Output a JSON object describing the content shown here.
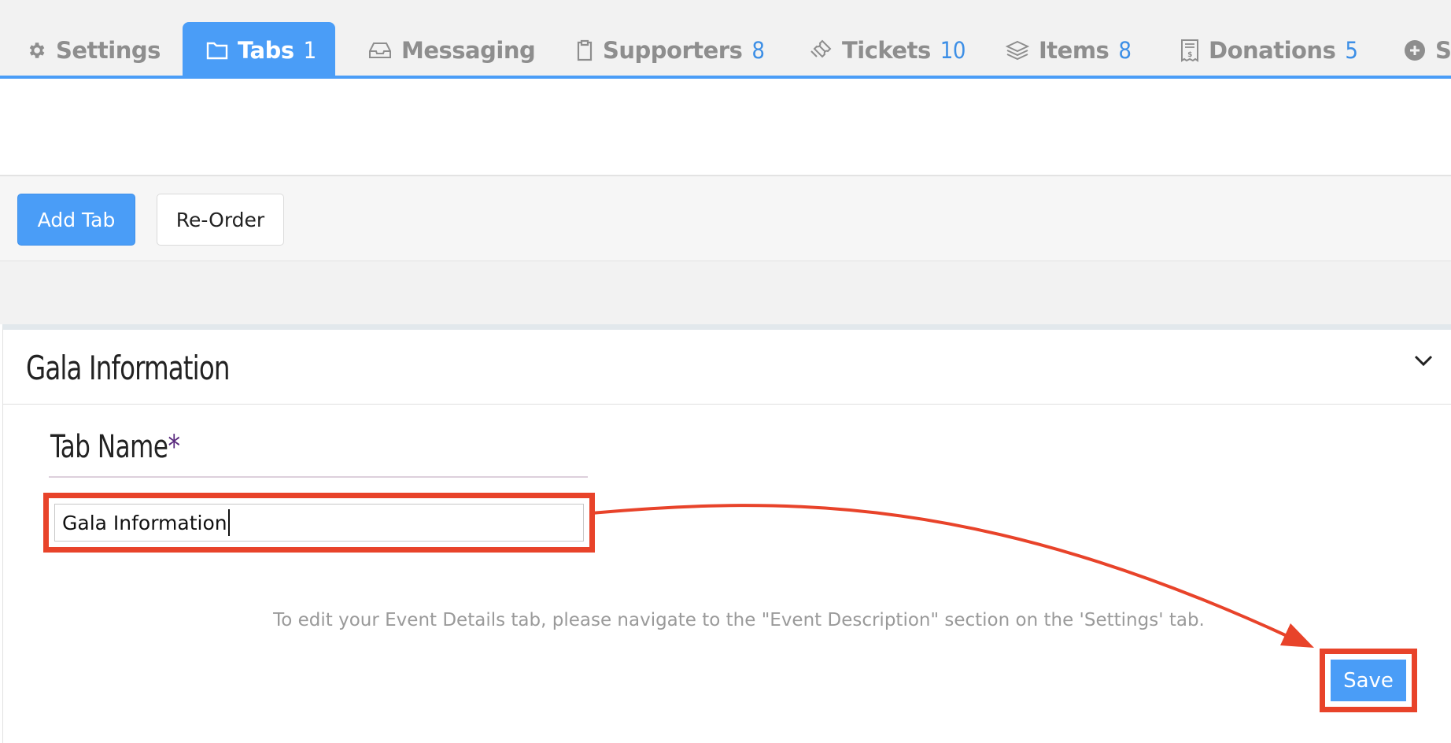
{
  "tabs": [
    {
      "label": "Settings",
      "icon": "gear-icon",
      "count": null,
      "active": false
    },
    {
      "label": "Tabs",
      "icon": "folder-icon",
      "count": "1",
      "active": true
    },
    {
      "label": "Messaging",
      "icon": "inbox-icon",
      "count": null,
      "active": false
    },
    {
      "label": "Supporters",
      "icon": "clipboard-icon",
      "count": "8",
      "active": false
    },
    {
      "label": "Tickets",
      "icon": "ticket-icon",
      "count": "10",
      "active": false
    },
    {
      "label": "Items",
      "icon": "layers-icon",
      "count": "8",
      "active": false
    },
    {
      "label": "Donations",
      "icon": "receipt-icon",
      "count": "5",
      "active": false
    },
    {
      "label": "S",
      "icon": "plus-circle-icon",
      "count": null,
      "active": false
    }
  ],
  "toolbar": {
    "add_tab_label": "Add Tab",
    "reorder_label": "Re-Order"
  },
  "panel": {
    "title": "Gala Information",
    "field_label": "Tab Name",
    "required_mark": "*",
    "field_value": "Gala Information",
    "help_text": "To edit your Event Details tab, please navigate to the \"Event Description\" section on the 'Settings' tab.",
    "save_label": "Save"
  },
  "colors": {
    "accent": "#4a9df7",
    "count": "#3d8fe6",
    "annotation": "#e8432a",
    "required": "#5a2a7e"
  }
}
